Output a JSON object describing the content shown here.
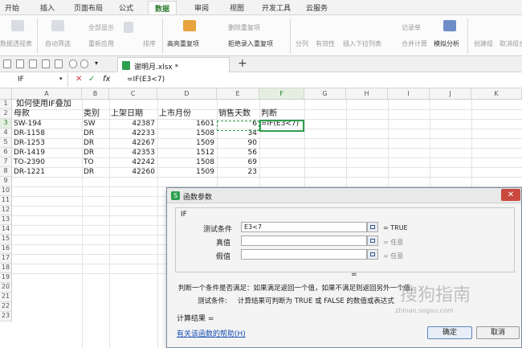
{
  "ribbon_tabs": [
    "开始",
    "插入",
    "页面布局",
    "公式",
    "数据",
    "审阅",
    "视图",
    "开发工具",
    "云服务"
  ],
  "active_tab": "数据",
  "ribbon": {
    "btn_validation_view": "数据透视表",
    "btn_autofilter": "自动筛选",
    "btn_show_all": "全部显示",
    "btn_reapply": "重新应用",
    "btn_sort_asc": "升序",
    "btn_sort": "排序",
    "btn_highlight_dup": "高亮重复项",
    "btn_delete_dup": "删除重复项",
    "btn_reject_dup": "拒绝录入重复项",
    "btn_split": "分列",
    "btn_validity": "有效性",
    "btn_dropdown": "插入下拉列表",
    "btn_consolidate": "合并计算",
    "btn_records": "记录单",
    "btn_simulate": "模拟分析",
    "btn_group": "创建组",
    "btn_ungroup": "取消组合"
  },
  "doc_tab": {
    "name": "谢明月.xlsx *",
    "new_tab": "+"
  },
  "formula_bar": {
    "name_box": "IF",
    "cancel": "✕",
    "confirm": "✓",
    "fx": "fx",
    "formula": "=IF(E3<7)"
  },
  "columns": [
    "A",
    "B",
    "C",
    "D",
    "E",
    "F",
    "G",
    "H",
    "I",
    "J",
    "K"
  ],
  "rows": [
    "1",
    "2",
    "3",
    "4",
    "5",
    "6",
    "7",
    "8",
    "9",
    "10",
    "11",
    "12",
    "13",
    "14",
    "15",
    "16",
    "17",
    "18",
    "19",
    "20",
    "21",
    "22",
    "23"
  ],
  "sheet": {
    "title": "如何使用IF叠加",
    "headers": [
      "母款",
      "类别",
      "上架日期",
      "上市月份",
      "销售天数",
      "判断"
    ],
    "data": [
      [
        "SW-194",
        "SW",
        "42387",
        "1601",
        "6",
        "=IF(E3<7)"
      ],
      [
        "DR-1158",
        "DR",
        "42233",
        "1508",
        "34",
        ""
      ],
      [
        "DR-1253",
        "DR",
        "42267",
        "1509",
        "90",
        ""
      ],
      [
        "DR-1419",
        "DR",
        "42353",
        "1512",
        "56",
        ""
      ],
      [
        "TO-2390",
        "TO",
        "42242",
        "1508",
        "69",
        ""
      ],
      [
        "DR-1221",
        "DR",
        "42260",
        "1509",
        "23",
        ""
      ]
    ]
  },
  "dialog": {
    "title": "函数参数",
    "logo": "S",
    "close": "✕",
    "function_name": "IF",
    "args": [
      {
        "label": "测试条件",
        "value": "E3<7",
        "result": "= TRUE"
      },
      {
        "label": "真值",
        "value": "",
        "result": "= 任意"
      },
      {
        "label": "假值",
        "value": "",
        "result": "= 任意"
      }
    ],
    "equals_line": "=",
    "description": "判断一个条件是否满足：如果满足返回一个值，如果不满足则返回另外一个值。",
    "arg_help_label": "测试条件:",
    "arg_help": "计算结果可判断为 TRUE 或 FALSE 的数值或表达式",
    "result_label": "计算结果 =",
    "help_link": "有关该函数的帮助(H)",
    "ok": "确定",
    "cancel": "取消"
  },
  "watermark": {
    "text": "搜狗指南",
    "sub": "zhinan.sogou.com"
  },
  "colors": {
    "accent": "#2e9e4f",
    "close": "#c9493e",
    "link": "#1a4fb3"
  }
}
